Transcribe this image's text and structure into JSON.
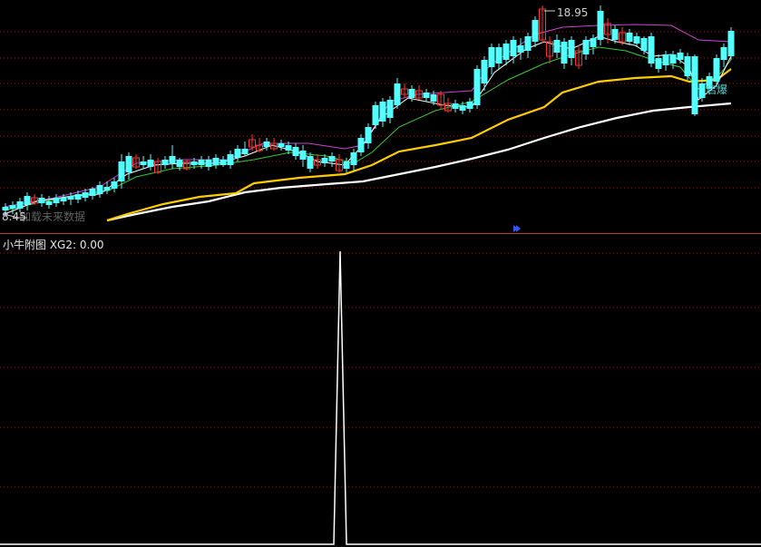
{
  "main_chart": {
    "high_price_label": "18.95",
    "low_price_label": "8.45",
    "overlay_text": "加载未来数据",
    "marker_label": "启爆",
    "colors": {
      "bull": "#ff3333",
      "bear": "#54ffff",
      "ma_short": "#ffffff",
      "ma_mid": "#ffcc00",
      "ma_green": "#33cc33",
      "ma_purple": "#cc44cc",
      "ma_white": "#ffffff",
      "grid": "#8b1a1a"
    }
  },
  "sub_chart": {
    "title": "小牛附图  XG2: 0.00",
    "line_color": "#ffffff"
  }
}
